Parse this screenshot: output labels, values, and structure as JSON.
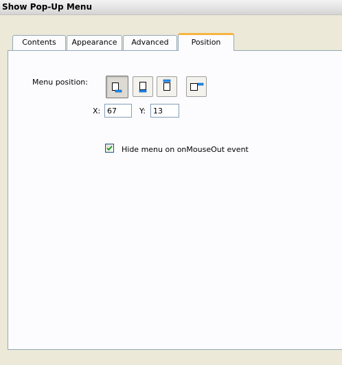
{
  "window": {
    "title": "Show Pop-Up Menu"
  },
  "tabs": [
    {
      "label": "Contents",
      "active": false
    },
    {
      "label": "Appearance",
      "active": false
    },
    {
      "label": "Advanced",
      "active": false
    },
    {
      "label": "Position",
      "active": true
    }
  ],
  "position": {
    "menu_position_label": "Menu position:",
    "buttons": [
      {
        "name": "below-right",
        "selected": true
      },
      {
        "name": "below",
        "selected": false
      },
      {
        "name": "above",
        "selected": false
      },
      {
        "name": "right-top",
        "selected": false
      }
    ],
    "x_label": "X:",
    "x_value": "67",
    "y_label": "Y:",
    "y_value": "13"
  },
  "hide_menu": {
    "checked": true,
    "label": "Hide menu on onMouseOut event"
  },
  "colors": {
    "active_tab_accent": "#f7b33d",
    "icon_blue": "#1e90ff",
    "checkmark_green": "#21a121"
  }
}
